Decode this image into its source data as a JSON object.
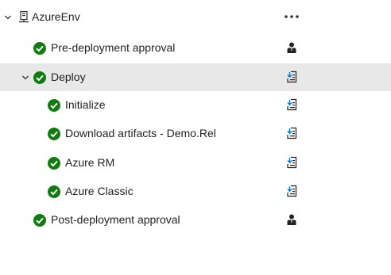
{
  "tree": {
    "environment": {
      "name": "AzureEnv",
      "icon": "server-icon",
      "more_icon": "more-options-icon"
    },
    "pre_deployment": {
      "label": "Pre-deployment approval",
      "status": "succeeded",
      "action_icon": "approver-person-icon"
    },
    "deploy": {
      "label": "Deploy",
      "status": "succeeded",
      "action_icon": "download-log-icon",
      "expanded": true,
      "tasks": [
        {
          "label": "Initialize",
          "status": "succeeded",
          "action_icon": "download-log-icon"
        },
        {
          "label": "Download artifacts - Demo.Rel",
          "status": "succeeded",
          "action_icon": "download-log-icon"
        },
        {
          "label": "Azure RM",
          "status": "succeeded",
          "action_icon": "download-log-icon"
        },
        {
          "label": "Azure Classic",
          "status": "succeeded",
          "action_icon": "download-log-icon"
        }
      ]
    },
    "post_deployment": {
      "label": "Post-deployment approval",
      "status": "succeeded",
      "action_icon": "approver-person-icon"
    }
  },
  "colors": {
    "success": "#107c10",
    "selected_row": "#e8e8e8",
    "text": "#1f1f1f",
    "icon": "#333333"
  }
}
